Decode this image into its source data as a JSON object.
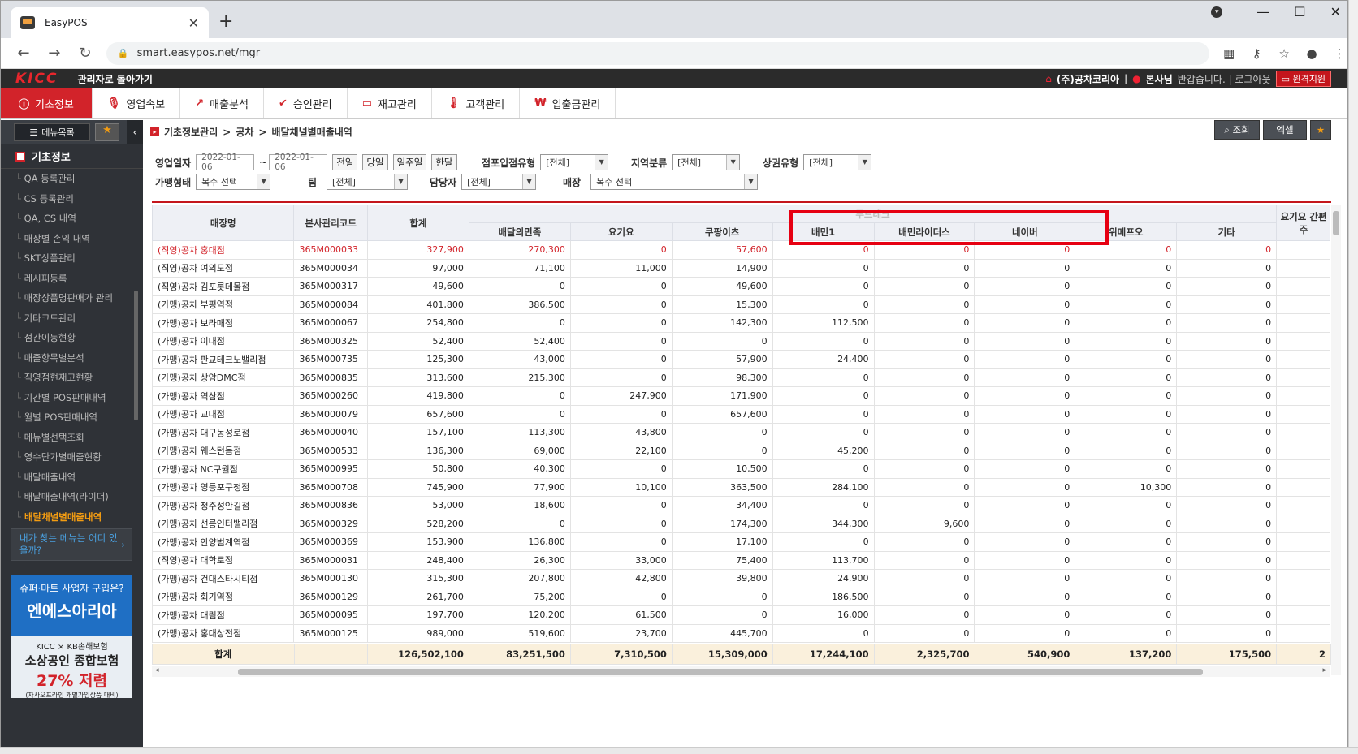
{
  "browser": {
    "tab_title": "EasyPOS",
    "url": "smart.easypos.net/mgr"
  },
  "header": {
    "logo": "KICC",
    "back_link": "관리자로 돌아가기",
    "company": "(주)공차코리아",
    "user": "본사님",
    "greeting": "반갑습니다. | 로그아웃",
    "remote": "원격지원"
  },
  "main_menu": [
    {
      "label": "기초정보",
      "icon": "info-icon",
      "glyph": "ⓘ"
    },
    {
      "label": "영업속보",
      "icon": "mic-icon",
      "glyph": "🎙"
    },
    {
      "label": "매출분석",
      "icon": "trend-icon",
      "glyph": "↗"
    },
    {
      "label": "승인관리",
      "icon": "check-icon",
      "glyph": "✔"
    },
    {
      "label": "재고관리",
      "icon": "monitor-icon",
      "glyph": "▭"
    },
    {
      "label": "고객관리",
      "icon": "thermometer-icon",
      "glyph": "🌡"
    },
    {
      "label": "입출금관리",
      "icon": "won-icon",
      "glyph": "₩"
    }
  ],
  "sidebar": {
    "menu_button": "메뉴목록",
    "section_title": "기초정보",
    "items": [
      "QA 등록관리",
      "CS 등록관리",
      "QA, CS 내역",
      "매장별 손익 내역",
      "SKT상품관리",
      "레시피등록",
      "매장상품명판매가 관리",
      "기타코드관리",
      "점간이동현황",
      "매출항목별분석",
      "직영점현재고현황",
      "기간별 POS판매내역",
      "월별 POS판매내역",
      "메뉴별선택조회",
      "영수단가별매출현황",
      "배달매출내역",
      "배달매출내역(라이더)",
      "배달채널별매출내역"
    ],
    "active_index": 17,
    "find_menu": "내가 찾는 메뉴는 어디 있을까?",
    "ad1_small": "슈퍼·마트 사업자 구입은?",
    "ad1_big": "엔에스아리아",
    "ad2_logos": "KICC × KB손해보험",
    "ad2_title": "소상공인 종합보험",
    "ad2_percent": "27% 저렴",
    "ad2_note": "(자사오프라인 개별가입상품 대비)"
  },
  "breadcrumb": [
    "기초정보관리",
    "공차",
    "배달채널별매출내역"
  ],
  "toolbar": {
    "search": "조회",
    "excel": "엑셀"
  },
  "filters": {
    "date_label": "영업일자",
    "date_from": "2022-01-06",
    "date_to": "2022-01-06",
    "quick": [
      "전일",
      "당일",
      "일주일",
      "한달"
    ],
    "store_entry_label": "점포입점유형",
    "store_entry_value": "[전체]",
    "region_label": "지역분류",
    "region_value": "[전체]",
    "commercial_label": "상권유형",
    "commercial_value": "[전체]",
    "franchise_label": "가맹형태",
    "franchise_value": "복수 선택",
    "team_label": "팀",
    "team_value": "[전체]",
    "manager_label": "담당자",
    "manager_value": "[전체]",
    "store_label": "매장",
    "store_value": "복수 선택"
  },
  "table": {
    "group_header": "푸드테크",
    "headers": [
      "매장명",
      "본사관리코드",
      "합계",
      "배달의민족",
      "요기요",
      "쿠팡이츠",
      "배민1",
      "배민라이더스",
      "네이버",
      "위메프오",
      "기타",
      "요기요 간편주"
    ],
    "rows": [
      [
        "(직영)공차 홍대점",
        "365M000033",
        "327,900",
        "270,300",
        "0",
        "57,600",
        "0",
        "0",
        "0",
        "0",
        "0"
      ],
      [
        "(직영)공차 여의도점",
        "365M000034",
        "97,000",
        "71,100",
        "11,000",
        "14,900",
        "0",
        "0",
        "0",
        "0",
        "0"
      ],
      [
        "(직영)공차 김포롯데몰점",
        "365M000317",
        "49,600",
        "0",
        "0",
        "49,600",
        "0",
        "0",
        "0",
        "0",
        "0"
      ],
      [
        "(가맹)공차 부평역점",
        "365M000084",
        "401,800",
        "386,500",
        "0",
        "15,300",
        "0",
        "0",
        "0",
        "0",
        "0"
      ],
      [
        "(가맹)공차 보라매점",
        "365M000067",
        "254,800",
        "0",
        "0",
        "142,300",
        "112,500",
        "0",
        "0",
        "0",
        "0"
      ],
      [
        "(가맹)공차 이대점",
        "365M000325",
        "52,400",
        "52,400",
        "0",
        "0",
        "0",
        "0",
        "0",
        "0",
        "0"
      ],
      [
        "(가맹)공차 판교테크노밸리점",
        "365M000735",
        "125,300",
        "43,000",
        "0",
        "57,900",
        "24,400",
        "0",
        "0",
        "0",
        "0"
      ],
      [
        "(가맹)공차 상암DMC점",
        "365M000835",
        "313,600",
        "215,300",
        "0",
        "98,300",
        "0",
        "0",
        "0",
        "0",
        "0"
      ],
      [
        "(가맹)공차 역삼점",
        "365M000260",
        "419,800",
        "0",
        "247,900",
        "171,900",
        "0",
        "0",
        "0",
        "0",
        "0"
      ],
      [
        "(가맹)공차 교대점",
        "365M000079",
        "657,600",
        "0",
        "0",
        "657,600",
        "0",
        "0",
        "0",
        "0",
        "0"
      ],
      [
        "(가맹)공차 대구동성로점",
        "365M000040",
        "157,100",
        "113,300",
        "43,800",
        "0",
        "0",
        "0",
        "0",
        "0",
        "0"
      ],
      [
        "(가맹)공차 웨스턴돔점",
        "365M000533",
        "136,300",
        "69,000",
        "22,100",
        "0",
        "45,200",
        "0",
        "0",
        "0",
        "0"
      ],
      [
        "(가맹)공차 NC구월점",
        "365M000995",
        "50,800",
        "40,300",
        "0",
        "10,500",
        "0",
        "0",
        "0",
        "0",
        "0"
      ],
      [
        "(가맹)공차 영등포구청점",
        "365M000708",
        "745,900",
        "77,900",
        "10,100",
        "363,500",
        "284,100",
        "0",
        "0",
        "10,300",
        "0"
      ],
      [
        "(가맹)공차 청주성안길점",
        "365M000836",
        "53,000",
        "18,600",
        "0",
        "34,400",
        "0",
        "0",
        "0",
        "0",
        "0"
      ],
      [
        "(가맹)공차 선릉인터밸리점",
        "365M000329",
        "528,200",
        "0",
        "0",
        "174,300",
        "344,300",
        "9,600",
        "0",
        "0",
        "0"
      ],
      [
        "(가맹)공차 안양범계역점",
        "365M000369",
        "153,900",
        "136,800",
        "0",
        "17,100",
        "0",
        "0",
        "0",
        "0",
        "0"
      ],
      [
        "(직영)공차 대학로점",
        "365M000031",
        "248,400",
        "26,300",
        "33,000",
        "75,400",
        "113,700",
        "0",
        "0",
        "0",
        "0"
      ],
      [
        "(가맹)공차 건대스타시티점",
        "365M000130",
        "315,300",
        "207,800",
        "42,800",
        "39,800",
        "24,900",
        "0",
        "0",
        "0",
        "0"
      ],
      [
        "(가맹)공차 회기역점",
        "365M000129",
        "261,700",
        "75,200",
        "0",
        "0",
        "186,500",
        "0",
        "0",
        "0",
        "0"
      ],
      [
        "(가맹)공차 대림점",
        "365M000095",
        "197,700",
        "120,200",
        "61,500",
        "0",
        "16,000",
        "0",
        "0",
        "0",
        "0"
      ],
      [
        "(가맹)공차 홍대상전점",
        "365M000125",
        "989,000",
        "519,600",
        "23,700",
        "445,700",
        "0",
        "0",
        "0",
        "0",
        "0"
      ]
    ],
    "footer": [
      "합계",
      "",
      "126,502,100",
      "83,251,500",
      "7,310,500",
      "15,309,000",
      "17,244,100",
      "2,325,700",
      "540,900",
      "137,200",
      "175,500",
      "2"
    ]
  }
}
